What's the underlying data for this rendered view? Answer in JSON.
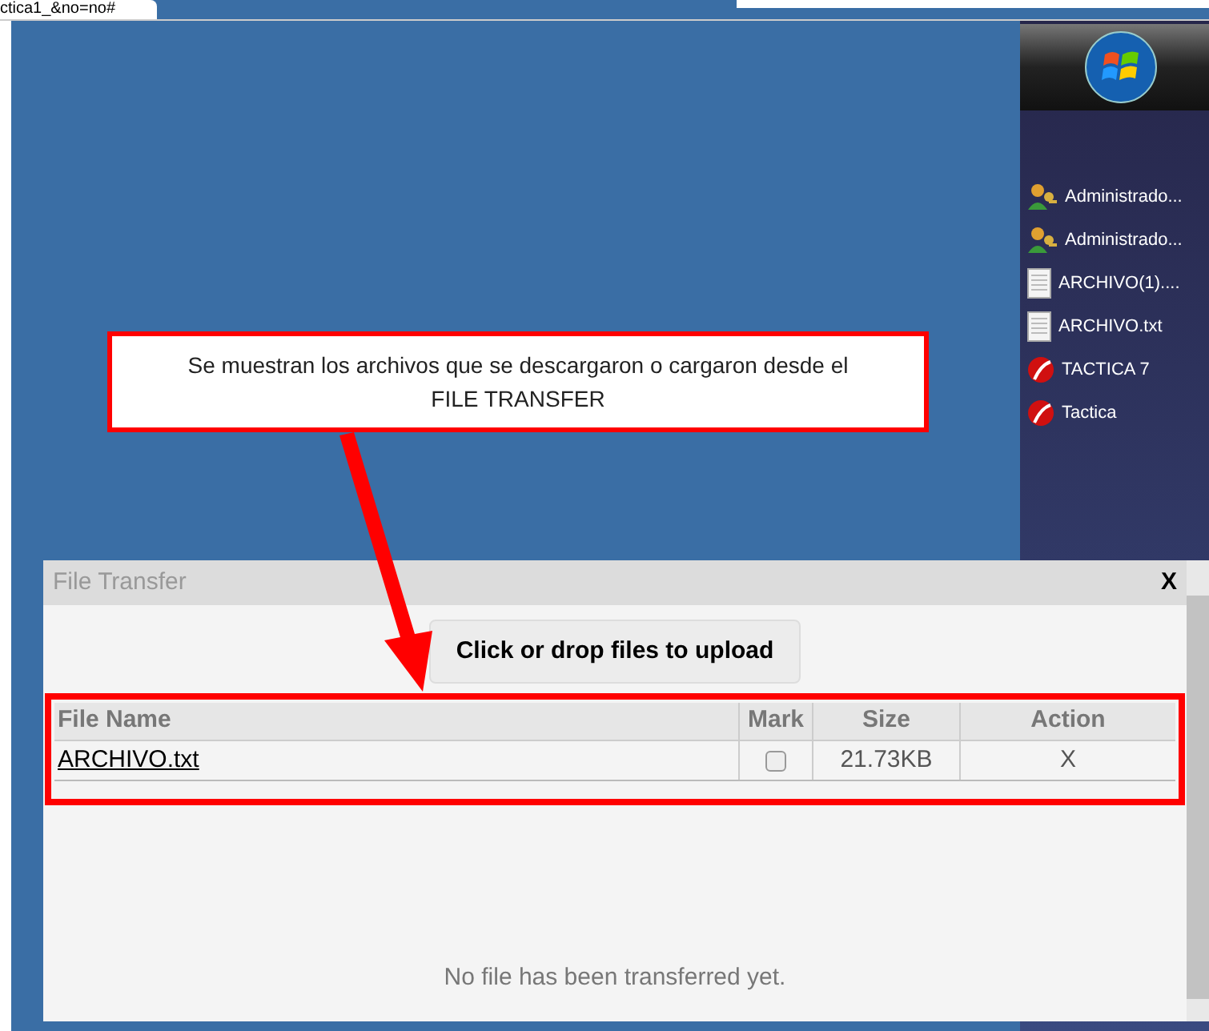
{
  "browser_tab": {
    "title": "ctica1_&no=no#"
  },
  "desktop_items": [
    {
      "kind": "user",
      "label": "Administrado..."
    },
    {
      "kind": "user",
      "label": "Administrado..."
    },
    {
      "kind": "file",
      "label": "ARCHIVO(1)...."
    },
    {
      "kind": "file",
      "label": "ARCHIVO.txt"
    },
    {
      "kind": "app",
      "label": "TACTICA 7"
    },
    {
      "kind": "app",
      "label": "Tactica"
    }
  ],
  "callout": {
    "text": "Se muestran los archivos que se descargaron o cargaron desde el FILE TRANSFER"
  },
  "dialog": {
    "title": "File Transfer",
    "close": "X",
    "upload_button": "Click or drop files to upload",
    "table": {
      "columns": [
        "File Name",
        "Mark",
        "Size",
        "Action"
      ],
      "rows": [
        {
          "name": "ARCHIVO.txt",
          "checked": false,
          "size": "21.73KB",
          "action": "X"
        }
      ]
    },
    "empty_message": "No file has been transferred yet."
  }
}
